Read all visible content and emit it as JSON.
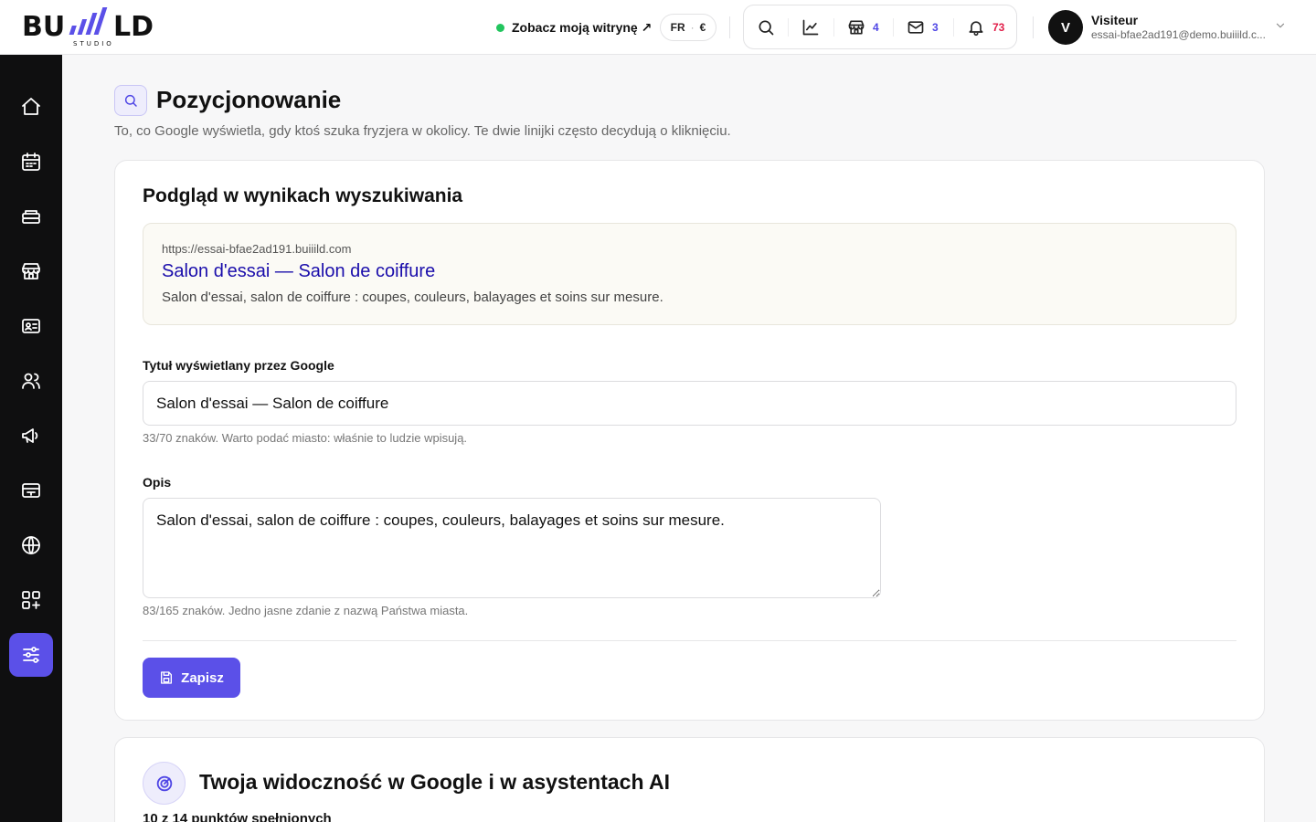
{
  "brand": {
    "logo_text": "BUILD",
    "logo_sub": "STUDIO"
  },
  "topbar": {
    "view_site_label": "Zobacz moją witrynę ↗",
    "lang": "FR",
    "currency": "€",
    "counts": {
      "shop": "4",
      "mail": "3",
      "notifications": "73"
    }
  },
  "user": {
    "initial": "V",
    "name": "Visiteur",
    "email": "essai-bfae2ad191@demo.buiiild.c..."
  },
  "page": {
    "title": "Pozycjonowanie",
    "subtitle": "To, co Google wyświetla, gdy ktoś szuka fryzjera w okolicy. Te dwie linijki często decydują o kliknięciu."
  },
  "preview_card": {
    "heading": "Podgląd w wynikach wyszukiwania",
    "url": "https://essai-bfae2ad191.buiiild.com",
    "title": "Salon d'essai — Salon de coiffure",
    "description": "Salon d'essai, salon de coiffure : coupes, couleurs, balayages et soins sur mesure."
  },
  "form": {
    "title_label": "Tytuł wyświetlany przez Google",
    "title_value": "Salon d'essai — Salon de coiffure",
    "title_help": "33/70 znaków. Warto podać miasto: właśnie to ludzie wpisują.",
    "desc_label": "Opis",
    "desc_value": "Salon d'essai, salon de coiffure : coupes, couleurs, balayages et soins sur mesure.",
    "desc_help": "83/165 znaków. Jedno jasne zdanie z nazwą Państwa miasta.",
    "save_label": "Zapisz"
  },
  "visibility": {
    "title": "Twoja widoczność w Google i w asystentach AI",
    "summary": "10 z 14 punktów spełnionych"
  },
  "colors": {
    "accent": "#5b50e8",
    "link": "#1a0dab",
    "online": "#22c55e",
    "notif": "#e11d48"
  }
}
